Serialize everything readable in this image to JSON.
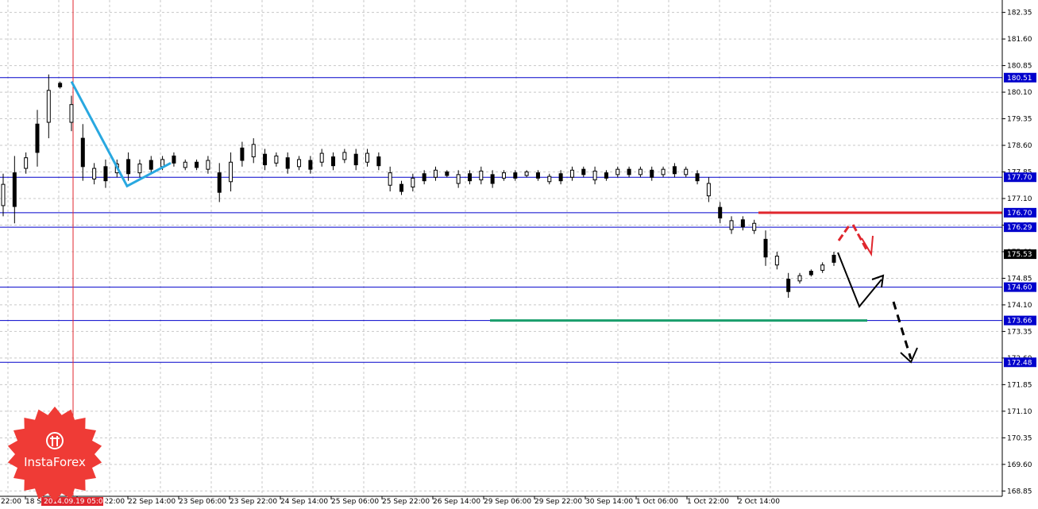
{
  "brand": {
    "name": "InstaForex",
    "color": "#ef3b36"
  },
  "chart_data": {
    "type": "candlestick",
    "ylim": [
      168.7,
      182.7
    ],
    "y_ticks": [
      "182.35",
      "181.60",
      "180.85",
      "180.10",
      "179.35",
      "178.60",
      "177.85",
      "177.10",
      "176.35",
      "175.60",
      "174.85",
      "174.10",
      "173.35",
      "172.60",
      "171.85",
      "171.10",
      "170.35",
      "169.60",
      "168.85"
    ],
    "x_ticks": [
      "18 Sep 22:00",
      "19 Sep 22:00",
      "22 Sep 14:00",
      "23 Sep 06:00",
      "23 Sep 22:00",
      "24 Sep 14:00",
      "25 Sep 06:00",
      "25 Sep 22:00",
      "26 Sep 14:00",
      "29 Sep 06:00",
      "29 Sep 22:00",
      "30 Sep 14:00",
      "1 Oct 06:00",
      "1 Oct 22:00",
      "2 Oct 14:00"
    ],
    "x_tick_first": "22:00",
    "cursor_date": "2014.09.19 05:00",
    "current_price": {
      "value": 175.53,
      "label": "175.53"
    },
    "horizontal_levels": [
      {
        "value": 180.51,
        "label": "180.51"
      },
      {
        "value": 177.7,
        "label": "177.70"
      },
      {
        "value": 176.7,
        "label": "176.70"
      },
      {
        "value": 176.29,
        "label": "176.29"
      },
      {
        "value": 174.6,
        "label": "174.60"
      },
      {
        "value": 173.66,
        "label": "173.66"
      },
      {
        "value": 172.48,
        "label": "172.48"
      }
    ],
    "level_color": "#0000cc",
    "resistance": {
      "value": 176.7,
      "color": "#e0262d"
    },
    "support": {
      "value": 173.66,
      "color": "#1a9e6c"
    },
    "wave_color": "#29a8e0",
    "candle_color": "#000000",
    "grid": true,
    "wave_points": [
      [
        178.3,
        0
      ],
      [
        177.4,
        1
      ],
      [
        178.1,
        2
      ]
    ],
    "candles": [
      [
        176.6,
        177.8
      ],
      [
        176.4,
        178.3
      ],
      [
        177.8,
        178.4
      ],
      [
        178.0,
        179.6
      ],
      [
        178.8,
        180.6
      ],
      [
        180.2,
        180.4
      ],
      [
        179.0,
        180.0
      ],
      [
        177.6,
        179.2
      ],
      [
        177.5,
        178.1
      ],
      [
        177.4,
        178.2
      ],
      [
        177.7,
        178.2
      ],
      [
        177.6,
        178.4
      ],
      [
        177.7,
        178.2
      ],
      [
        177.8,
        178.3
      ],
      [
        177.9,
        178.3
      ],
      [
        178.0,
        178.4
      ],
      [
        177.9,
        178.2
      ],
      [
        177.9,
        178.2
      ],
      [
        177.8,
        178.3
      ],
      [
        177.0,
        178.1
      ],
      [
        177.3,
        178.4
      ],
      [
        178.0,
        178.7
      ],
      [
        178.1,
        178.8
      ],
      [
        177.9,
        178.5
      ],
      [
        178.0,
        178.4
      ],
      [
        177.8,
        178.4
      ],
      [
        177.9,
        178.3
      ],
      [
        177.8,
        178.3
      ],
      [
        178.0,
        178.5
      ],
      [
        177.9,
        178.4
      ],
      [
        178.1,
        178.5
      ],
      [
        177.9,
        178.5
      ],
      [
        178.0,
        178.5
      ],
      [
        177.9,
        178.4
      ],
      [
        177.3,
        178.0
      ],
      [
        177.2,
        177.6
      ],
      [
        177.3,
        177.8
      ],
      [
        177.5,
        177.9
      ],
      [
        177.6,
        178.0
      ],
      [
        177.7,
        177.9
      ],
      [
        177.4,
        177.9
      ],
      [
        177.5,
        177.9
      ],
      [
        177.5,
        178.0
      ],
      [
        177.4,
        177.9
      ],
      [
        177.6,
        177.9
      ],
      [
        177.6,
        177.9
      ],
      [
        177.7,
        177.9
      ],
      [
        177.6,
        177.9
      ],
      [
        177.5,
        177.8
      ],
      [
        177.5,
        177.9
      ],
      [
        177.6,
        178.0
      ],
      [
        177.7,
        178.0
      ],
      [
        177.5,
        178.0
      ],
      [
        177.6,
        177.9
      ],
      [
        177.7,
        178.0
      ],
      [
        177.7,
        178.0
      ],
      [
        177.7,
        178.0
      ],
      [
        177.6,
        178.0
      ],
      [
        177.7,
        178.0
      ],
      [
        177.7,
        178.1
      ],
      [
        177.7,
        178.0
      ],
      [
        177.5,
        177.9
      ],
      [
        177.0,
        177.7
      ],
      [
        176.4,
        177.0
      ],
      [
        176.1,
        176.6
      ],
      [
        176.2,
        176.6
      ],
      [
        176.1,
        176.5
      ],
      [
        175.2,
        176.2
      ],
      [
        175.1,
        175.6
      ],
      [
        174.3,
        175.0
      ],
      [
        174.7,
        175.0
      ],
      [
        174.9,
        175.1
      ],
      [
        175.0,
        175.3
      ],
      [
        175.2,
        175.6
      ]
    ],
    "projections": [
      {
        "id": "red-proj",
        "color": "#e0262d"
      },
      {
        "id": "black-proj",
        "color": "#000000"
      }
    ]
  }
}
